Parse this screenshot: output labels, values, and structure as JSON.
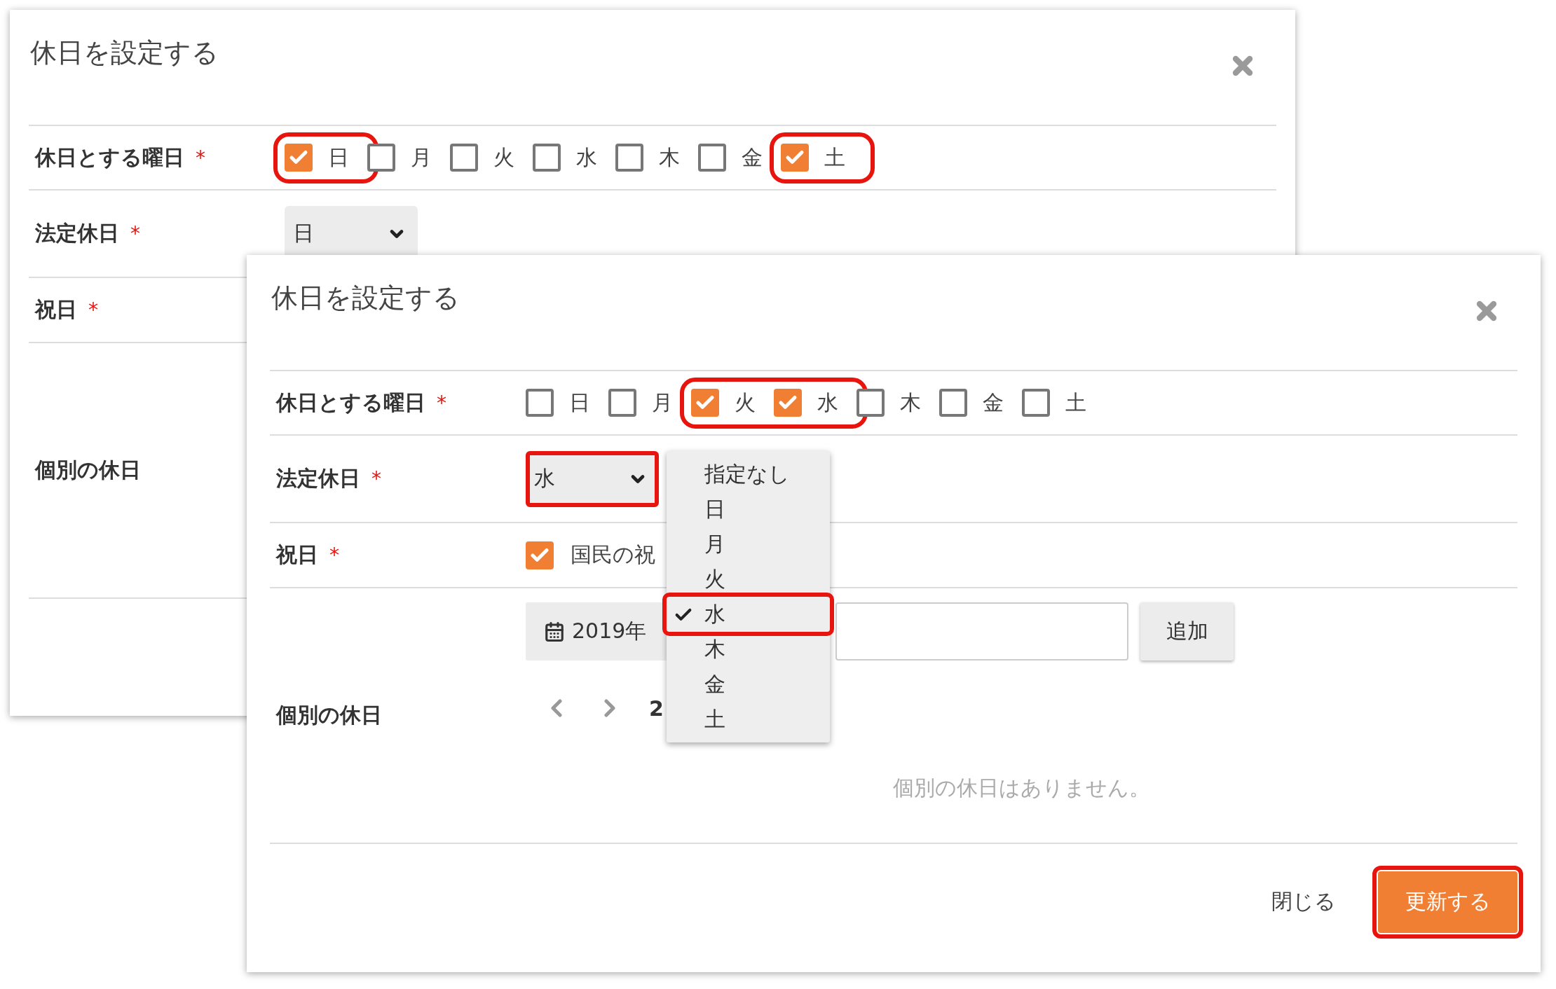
{
  "dialogs": [
    {
      "title": "休日を設定する",
      "fields": [
        {
          "kind": "weekdays",
          "label": "休日とする曜日",
          "marker": "*",
          "days": [
            {
              "label": "日",
              "checked": true,
              "highlighted": true
            },
            {
              "label": "月",
              "checked": false,
              "highlighted": false
            },
            {
              "label": "火",
              "checked": false,
              "highlighted": false
            },
            {
              "label": "水",
              "checked": false,
              "highlighted": false
            },
            {
              "label": "木",
              "checked": false,
              "highlighted": false
            },
            {
              "label": "金",
              "checked": false,
              "highlighted": false
            },
            {
              "label": "土",
              "checked": true,
              "highlighted": true
            }
          ]
        },
        {
          "kind": "select",
          "label": "法定休日",
          "marker": "*",
          "value": "日",
          "highlighted": false
        },
        {
          "kind": "blank",
          "label": "祝日",
          "marker": "*"
        },
        {
          "kind": "blank",
          "label": "個別の休日"
        }
      ]
    },
    {
      "title": "休日を設定する",
      "fields": [
        {
          "kind": "weekdays",
          "label": "休日とする曜日",
          "marker": "*",
          "days": [
            {
              "label": "日",
              "checked": false,
              "highlighted": false
            },
            {
              "label": "月",
              "checked": false,
              "highlighted": false
            },
            {
              "label": "火",
              "checked": true,
              "highlighted": true
            },
            {
              "label": "水",
              "checked": true,
              "highlighted": true
            },
            {
              "label": "木",
              "checked": false,
              "highlighted": false
            },
            {
              "label": "金",
              "checked": false,
              "highlighted": false
            },
            {
              "label": "土",
              "checked": false,
              "highlighted": false
            }
          ]
        },
        {
          "kind": "select",
          "label": "法定休日",
          "marker": "*",
          "value": "水",
          "highlighted": true,
          "options": [
            {
              "label": "指定なし",
              "selected": false,
              "highlighted": false
            },
            {
              "label": "日",
              "selected": false,
              "highlighted": false
            },
            {
              "label": "月",
              "selected": false,
              "highlighted": false
            },
            {
              "label": "火",
              "selected": false,
              "highlighted": false
            },
            {
              "label": "水",
              "selected": true,
              "highlighted": true
            },
            {
              "label": "木",
              "selected": false,
              "highlighted": false
            },
            {
              "label": "金",
              "selected": false,
              "highlighted": false
            },
            {
              "label": "土",
              "selected": false,
              "highlighted": false
            }
          ]
        },
        {
          "kind": "checkbox",
          "label": "祝日",
          "marker": "*",
          "checked": true,
          "text": "国民の祝"
        },
        {
          "kind": "holidays",
          "label": "個別の休日",
          "date_button": "2019年",
          "add_button": "追加",
          "month": "2",
          "empty_message": "個別の休日はありません。"
        }
      ],
      "buttons": [
        {
          "kind": "text",
          "label": "閉じる",
          "highlighted": false
        },
        {
          "kind": "primary",
          "label": "更新する",
          "highlighted": true
        }
      ]
    }
  ]
}
